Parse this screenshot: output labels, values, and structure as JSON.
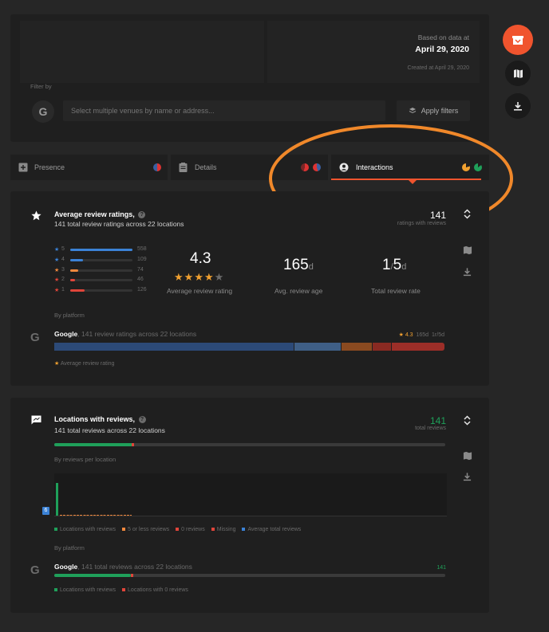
{
  "header": {
    "based_on": "Based on data at",
    "date": "April 29, 2020",
    "created": "Created at April 29, 2020",
    "filter_by": "Filter by",
    "search_placeholder": "Select multiple venues by name or address...",
    "apply_filters": "Apply filters"
  },
  "side_icons": [
    "gift-icon",
    "map-icon",
    "download-icon"
  ],
  "tabs": [
    {
      "label": "Presence"
    },
    {
      "label": "Details"
    },
    {
      "label": "Interactions",
      "active": true
    }
  ],
  "ratings": {
    "title": "Average review ratings,",
    "subtitle": "141 total review ratings across 22 locations",
    "total": "141",
    "total_label": "ratings with reviews",
    "stars": [
      {
        "label": "5",
        "count": "558",
        "fraction": 1.0,
        "color": "#3b82d6"
      },
      {
        "label": "4",
        "count": "109",
        "fraction": 0.2,
        "color": "#3b82d6"
      },
      {
        "label": "3",
        "count": "74",
        "fraction": 0.13,
        "color": "#f0883e"
      },
      {
        "label": "2",
        "count": "46",
        "fraction": 0.08,
        "color": "#e0453a"
      },
      {
        "label": "1",
        "count": "126",
        "fraction": 0.23,
        "color": "#e0453a"
      }
    ],
    "avg": "4.3",
    "avg_label": "Average review rating",
    "age_value": "165",
    "age_unit": "d",
    "age_label": "Avg. review age",
    "rate_value": "1",
    "rate_unit": "/",
    "rate_value2": "5",
    "rate_unit2": "d",
    "rate_label": "Total review rate",
    "by_platform": "By platform",
    "platform": {
      "name": "Google",
      "desc": ", 141 review ratings across 22 locations",
      "rating": "4.3",
      "age": "165d",
      "rate": "1r/5d",
      "segments": [
        {
          "fraction": 0.614,
          "color": "#2c4a78"
        },
        {
          "fraction": 0.12,
          "color": "#3f5f86"
        },
        {
          "fraction": 0.08,
          "color": "#8a4a20"
        },
        {
          "fraction": 0.05,
          "color": "#8a2a22"
        },
        {
          "fraction": 0.136,
          "color": "#9c2e28"
        }
      ]
    },
    "legend": "Average review rating"
  },
  "locations": {
    "title": "Locations with reviews,",
    "subtitle": "141 total reviews across 22 locations",
    "total": "141",
    "total_label": "total reviews",
    "progress_fraction": 0.2,
    "by_reviews": "By reviews per location",
    "axis_badge": "6",
    "legend": [
      {
        "label": "Locations with reviews",
        "color": "#1fa05a"
      },
      {
        "label": "5 or less reviews",
        "color": "#f0883e"
      },
      {
        "label": "0 reviews",
        "color": "#e0453a"
      },
      {
        "label": "Missing",
        "color": "#e0453a"
      },
      {
        "label": "Average total reviews",
        "color": "#3b82d6"
      }
    ],
    "by_platform": "By platform",
    "platform": {
      "name": "Google",
      "desc": ", 141 total reviews across 22 locations",
      "count": "141",
      "fraction": 0.195
    },
    "legend2": [
      {
        "label": "Locations with reviews",
        "color": "#1fa05a"
      },
      {
        "label": "Locations with 0 reviews",
        "color": "#e0453a"
      }
    ]
  }
}
